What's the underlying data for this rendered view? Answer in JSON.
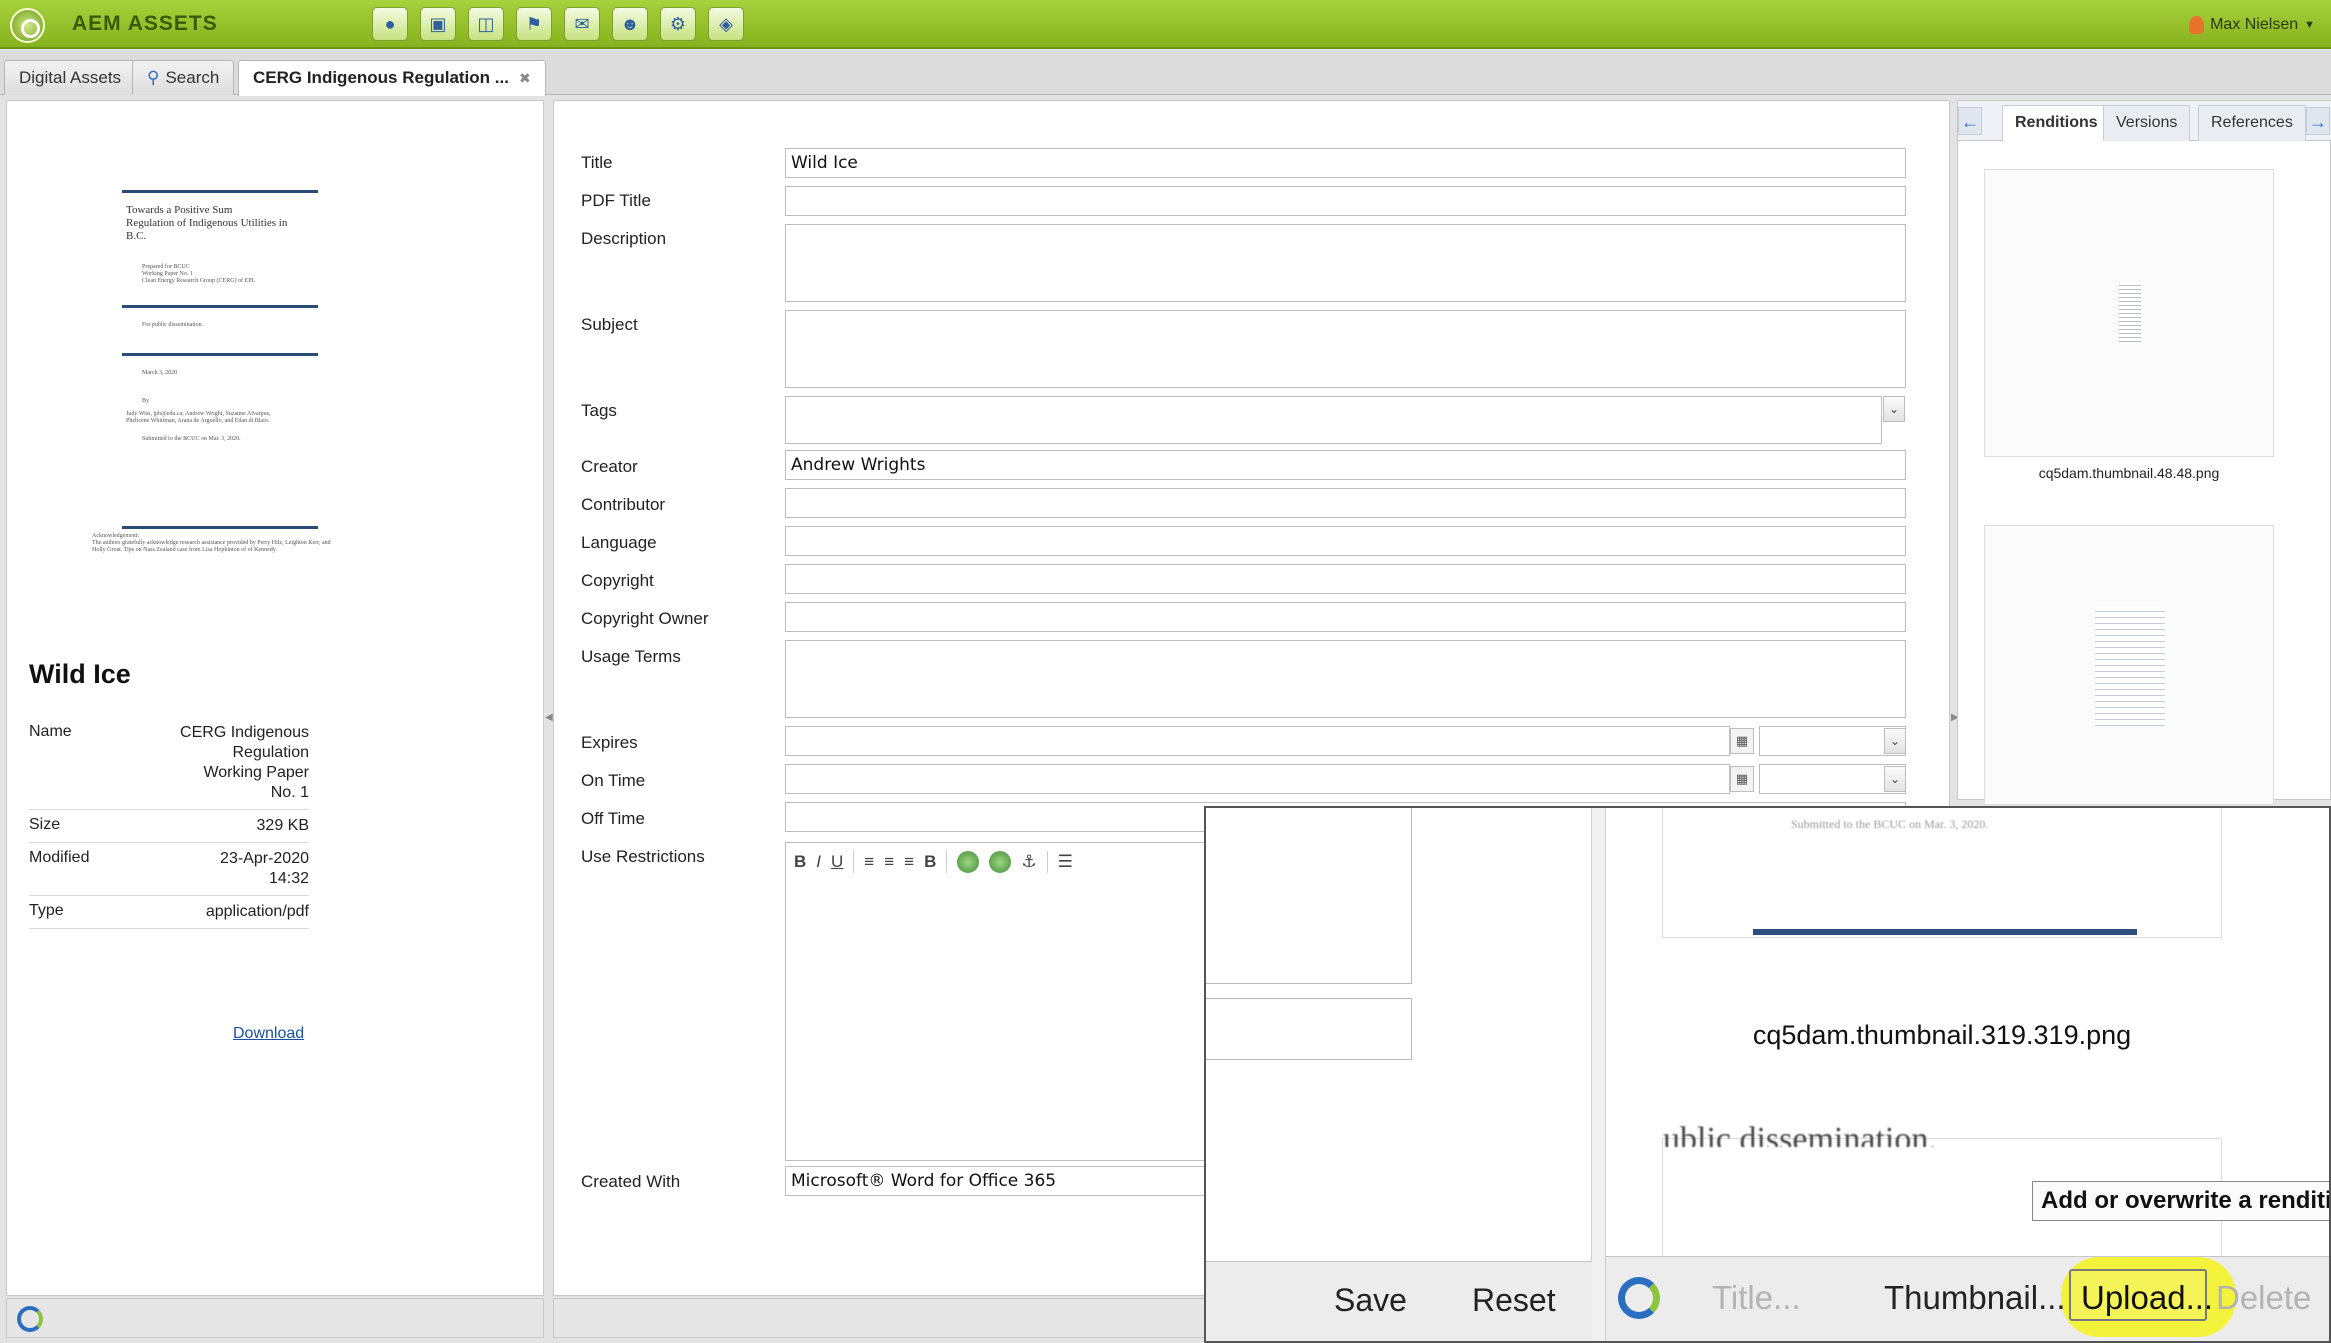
{
  "app": {
    "title": "AEM ASSETS"
  },
  "toolbar_icons": [
    "globe-icon",
    "assets-icon",
    "sites-icon",
    "campaigns-icon",
    "inbox-icon",
    "users-icon",
    "tools-icon",
    "tagging-icon"
  ],
  "user": {
    "name": "Max Nielsen"
  },
  "tabs": [
    {
      "label": "Digital Assets"
    },
    {
      "label": "Search"
    },
    {
      "label": "CERG Indigenous Regulation ..."
    }
  ],
  "preview": {
    "title_lines": [
      "Towards a Positive Sum",
      "Regulation of Indigenous Utilities in",
      "B.C."
    ],
    "prepared_lines": [
      "Prepared for BCUC",
      "Working Paper No. 1",
      "Clean Energy Research Group (CERG) of EPL"
    ],
    "public": "For public dissemination.",
    "date": "March 3, 2020",
    "by": "By",
    "authors_lines": [
      "Judy Wiss, jpb@edu.ca; Andrew Wright, Suzanne Alvarpus,",
      "Phelicene Whittman, Arana de Arguello, and Edan di Blaio."
    ],
    "submitted": "Submitted to the BCUC on Mar. 3, 2020.",
    "ack_title": "Acknowledgement:",
    "ack_lines": [
      "The authors gratefully acknowledge research assistance provided by Perry Hilz, Leighton Kerr, and",
      "Holly Groat. Tips on Nass Zealand case from Lisa Hopkinton of of Kennedy."
    ]
  },
  "asset": {
    "title": "Wild Ice",
    "meta": [
      {
        "key": "Name",
        "value": "CERG Indigenous Regulation Working Paper No. 1",
        "lines": [
          "CERG Indigenous",
          "Regulation",
          "Working Paper",
          "No. 1"
        ]
      },
      {
        "key": "Size",
        "value": "329 KB",
        "lines": [
          "329 KB"
        ]
      },
      {
        "key": "Modified",
        "value": "23-Apr-2020 14:32",
        "lines": [
          "23-Apr-2020",
          "14:32"
        ]
      },
      {
        "key": "Type",
        "value": "application/pdf",
        "lines": [
          "application/pdf"
        ]
      }
    ],
    "download_label": "Download"
  },
  "form": {
    "title_label": "Title",
    "title_value": "Wild Ice",
    "pdf_title_label": "PDF Title",
    "description_label": "Description",
    "subject_label": "Subject",
    "tags_label": "Tags",
    "creator_label": "Creator",
    "creator_value": "Andrew Wrights",
    "contributor_label": "Contributor",
    "language_label": "Language",
    "copyright_label": "Copyright",
    "copyright_owner_label": "Copyright Owner",
    "usage_terms_label": "Usage Terms",
    "expires_label": "Expires",
    "on_time_label": "On Time",
    "off_time_label": "Off Time",
    "use_restrictions_label": "Use Restrictions",
    "created_with_label": "Created With",
    "created_with_value": "Microsoft® Word for Office 365"
  },
  "rte_toolbar": {
    "bold": "B",
    "italic": "I",
    "underline": "U",
    "align_bold": "B"
  },
  "renditions": {
    "tabs": [
      {
        "label": "Renditions"
      },
      {
        "label": "Versions"
      },
      {
        "label": "References"
      }
    ],
    "items": [
      {
        "label": "cq5dam.thumbnail.48.48.png"
      },
      {
        "label": ""
      }
    ]
  },
  "zoom": {
    "preview_text": "Submitted to the BCUC on Mar. 3, 2020.",
    "rendition_label": "cq5dam.thumbnail.319.319.png",
    "partial_text": "ublic dissemination.",
    "save_label": "Save",
    "reset_label": "Reset",
    "title_btn": "Title...",
    "thumbnail_btn": "Thumbnail...",
    "upload_btn": "Upload...",
    "delete_btn": "Delete",
    "tooltip": "Add or overwrite a rendition"
  }
}
